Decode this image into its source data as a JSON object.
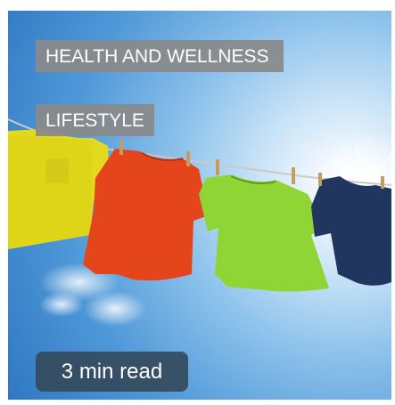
{
  "card": {
    "tags": [
      "HEALTH AND WELLNESS",
      "LIFESTYLE"
    ],
    "read_time": "3 min read",
    "image": {
      "subject": "clothes-line-with-shirts",
      "shirt_colors": [
        "#e4da1d",
        "#e5451b",
        "#8fd536",
        "#21365e"
      ],
      "sky_color": "#4f98d8"
    }
  }
}
